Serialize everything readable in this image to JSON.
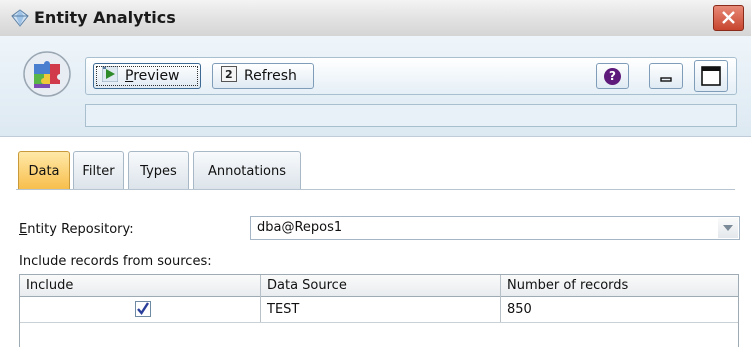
{
  "window": {
    "title": "Entity Analytics",
    "close_icon": "close-x-icon"
  },
  "toolbar": {
    "preview_label": "Preview",
    "preview_mnemonic": "P",
    "preview_rest": "review",
    "refresh_label": "Refresh",
    "help_symbol": "?",
    "status_text": ""
  },
  "tabs": [
    {
      "label": "Data",
      "active": true
    },
    {
      "label": "Filter",
      "active": false
    },
    {
      "label": "Types",
      "active": false
    },
    {
      "label": "Annotations",
      "active": false
    }
  ],
  "form": {
    "repository_label": "Entity Repository:",
    "repository_label_mnemonic": "E",
    "repository_label_rest": "ntity Repository:",
    "repository_value": "dba@Repos1",
    "include_label": "Include records from sources:"
  },
  "sources_table": {
    "columns": [
      "Include",
      "Data Source",
      "Number of records"
    ],
    "rows": [
      {
        "include": true,
        "data_source": "TEST",
        "records": "850"
      }
    ]
  },
  "colors": {
    "active_tab": "#f7bd49",
    "close_button": "#c7452e",
    "help_icon": "#5e1a7a"
  }
}
